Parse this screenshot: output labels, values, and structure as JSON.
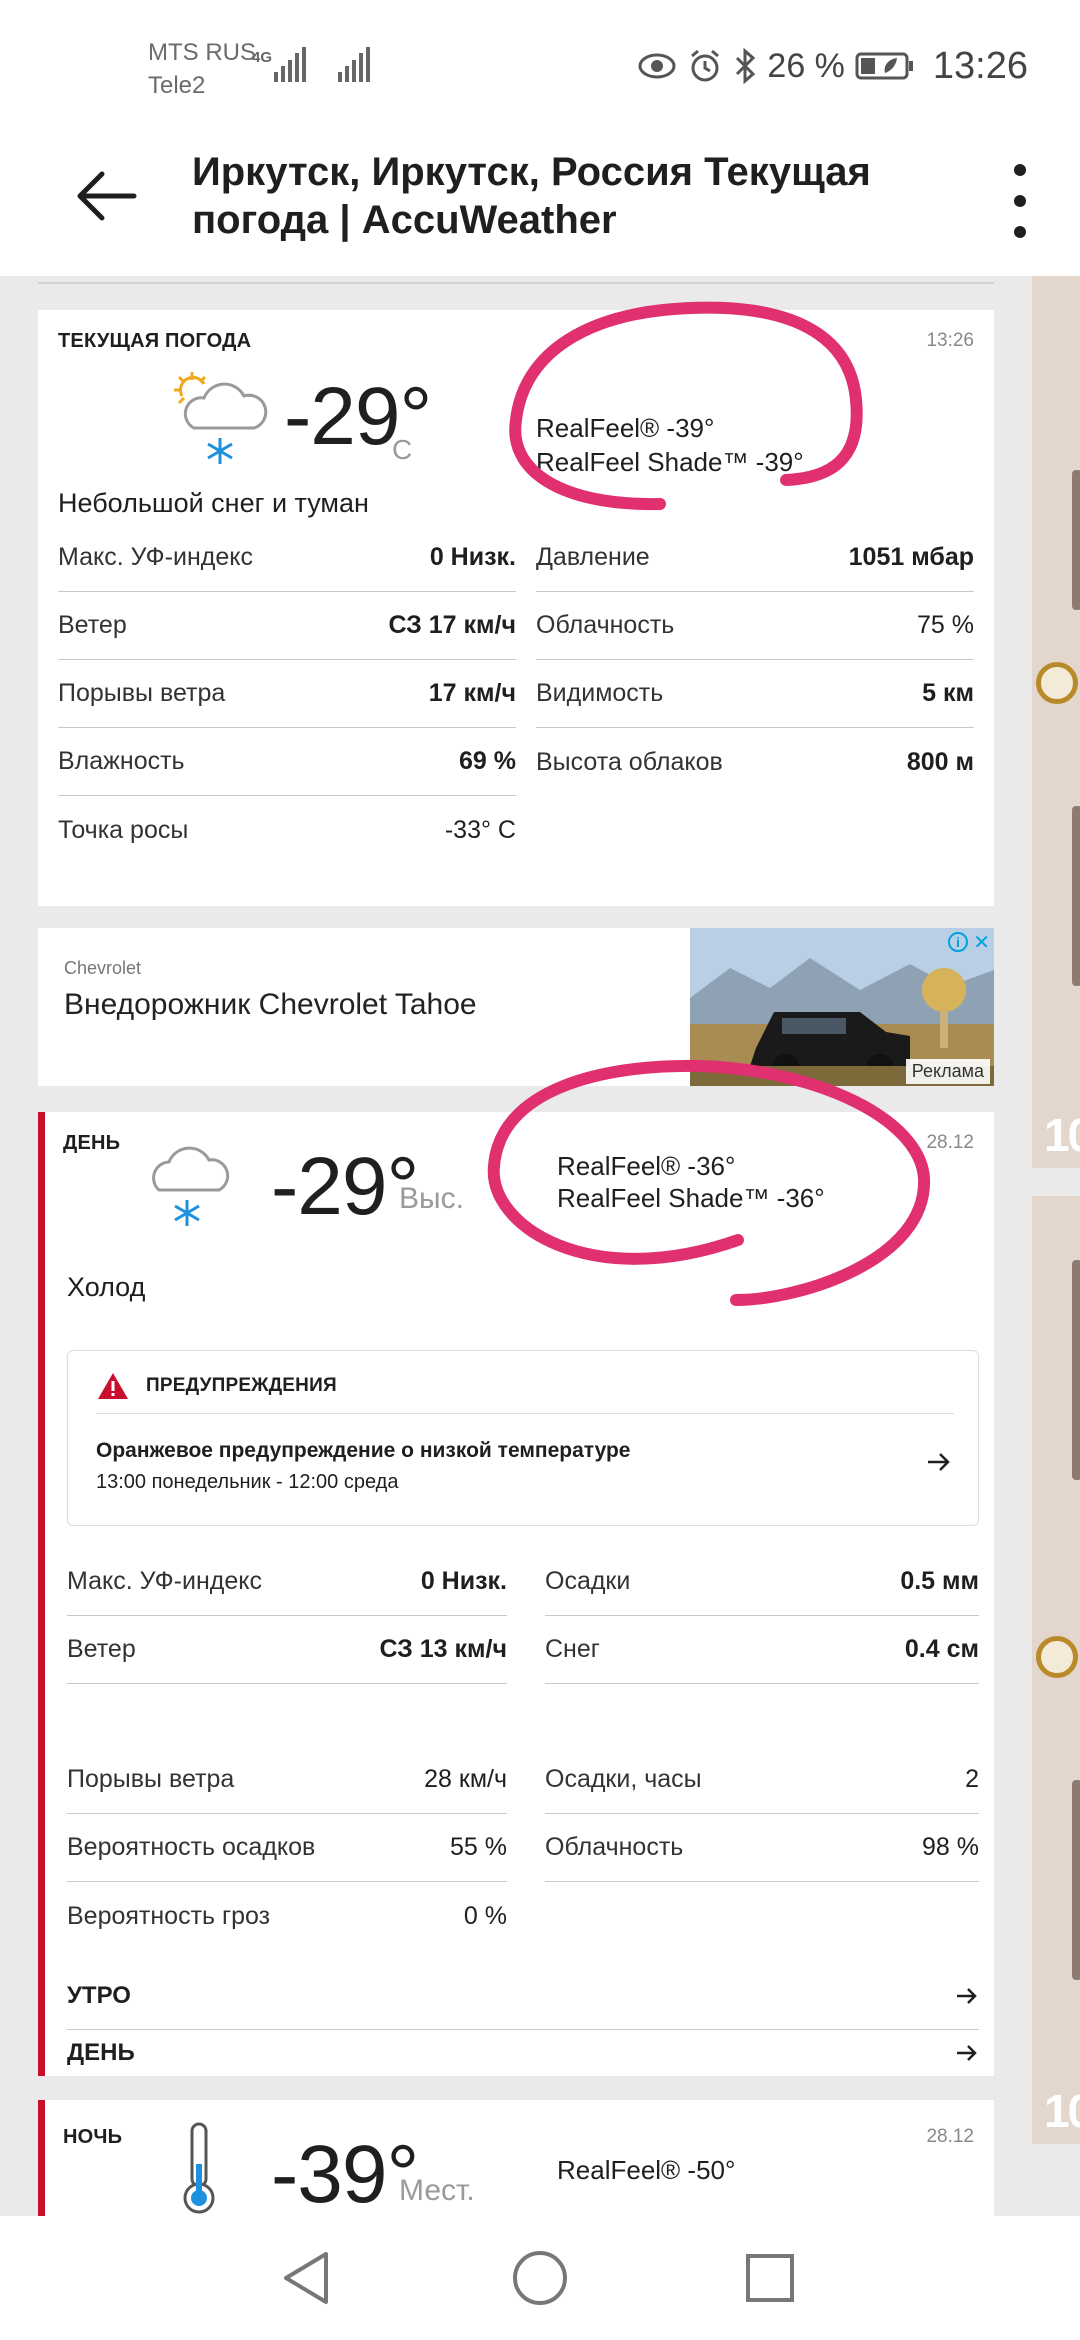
{
  "status_bar": {
    "carrier1": "MTS RUS",
    "carrier2": "Tele2",
    "network": "4G",
    "battery": "26 %",
    "time": "13:26"
  },
  "app_bar": {
    "title": "Иркутск, Иркутск, Россия Текущая погода | AccuWeather"
  },
  "current": {
    "label": "ТЕКУЩАЯ ПОГОДА",
    "time": "13:26",
    "temp": "-29°",
    "unit": "C",
    "realfeel": "RealFeel® -39°",
    "realfeel_shade": "RealFeel Shade™ -39°",
    "phrase": "Небольшой снег и туман",
    "left": [
      {
        "k": "Макс. УФ-индекс",
        "v": "0 Низк."
      },
      {
        "k": "Ветер",
        "v": "СЗ 17 км/ч"
      },
      {
        "k": "Порывы ветра",
        "v": "17 км/ч"
      },
      {
        "k": "Влажность",
        "v": "69 %"
      },
      {
        "k": "Точка росы",
        "v": "-33° C"
      }
    ],
    "right": [
      {
        "k": "Давление",
        "v": "1051 мбар"
      },
      {
        "k": "Облачность",
        "v": "75 %"
      },
      {
        "k": "Видимость",
        "v": "5 км"
      },
      {
        "k": "Высота облаков",
        "v": "800 м"
      }
    ]
  },
  "ad": {
    "brand": "Chevrolet",
    "title": "Внедорожник Chevrolet Tahoe",
    "tag": "Реклама"
  },
  "day": {
    "label": "ДЕНЬ",
    "date": "28.12",
    "temp": "-29°",
    "unit": "Выс.",
    "realfeel": "RealFeel® -36°",
    "realfeel_shade": "RealFeel Shade™ -36°",
    "phrase": "Холод",
    "alerts_label": "ПРЕДУПРЕЖДЕНИЯ",
    "alert_title": "Оранжевое предупреждение о низкой температуре",
    "alert_time": "13:00 понедельник - 12:00 среда",
    "left": [
      {
        "k": "Макс. УФ-индекс",
        "v": "0 Низк."
      },
      {
        "k": "Ветер",
        "v": "СЗ 13 км/ч"
      },
      {
        "k": "Порывы ветра",
        "v": "28 км/ч"
      },
      {
        "k": "Вероятность осадков",
        "v": "55 %"
      },
      {
        "k": "Вероятность гроз",
        "v": "0 %"
      }
    ],
    "right": [
      {
        "k": "Осадки",
        "v": "0.5 мм"
      },
      {
        "k": "Снег",
        "v": "0.4 см"
      },
      {
        "k": "Осадки, часы",
        "v": "2"
      },
      {
        "k": "Облачность",
        "v": "98 %"
      }
    ],
    "link_morning": "УТРО",
    "link_day": "ДЕНЬ"
  },
  "night": {
    "label": "НОЧЬ",
    "date": "28.12",
    "temp": "-39°",
    "unit": "Мест.",
    "realfeel": "RealFeel® -50°"
  },
  "peek": {
    "num1": "10",
    "num2": "10"
  },
  "colors": {
    "accent_red": "#c8102e",
    "annotation_pink": "#e0306f",
    "snow_blue": "#1e90e0"
  }
}
